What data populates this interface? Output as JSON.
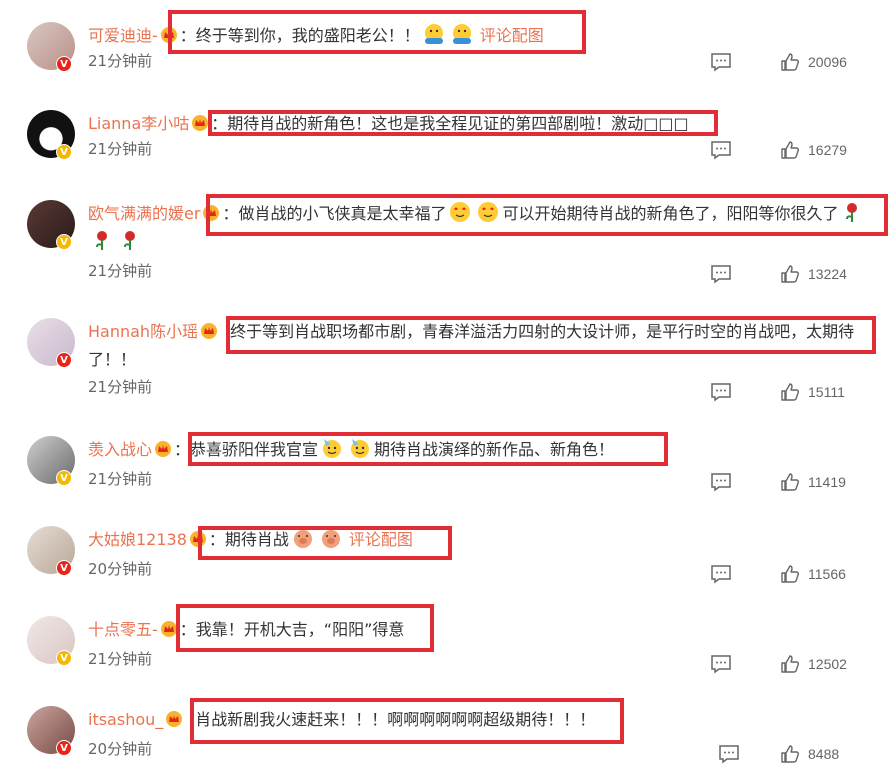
{
  "comments": [
    {
      "username": "可爱迪迪-",
      "text": "：终于等到你，我的盛阳老公！！",
      "emojis": [
        "emoji-palms",
        "emoji-palms"
      ],
      "tail": "评论配图",
      "time": "21分钟前",
      "likes": "20096",
      "badge": "red"
    },
    {
      "username": "Lianna李小咕",
      "text": "：期待肖战的新角色！这也是我全程见证的第四部剧啦！激动□□□",
      "emojis": [],
      "tail": "",
      "time": "21分钟前",
      "likes": "16279",
      "badge": "gold"
    },
    {
      "username": "欧气满满的媛er",
      "text": "：做肖战的小飞侠真是太幸福了",
      "emojis": [
        "emoji-hearts",
        "emoji-hearts"
      ],
      "text2": "可以开始期待肖战的新角色了，阳阳等你很久了",
      "emojis2": [
        "emoji-rose",
        "emoji-rose",
        "emoji-rose"
      ],
      "time": "21分钟前",
      "likes": "13224",
      "badge": "gold"
    },
    {
      "username": "Hannah陈小瑶",
      "text": "终于等到肖战职场都市剧，青春洋溢活力四射的大设计师，是平行时空的肖战吧，太期待了！！",
      "time": "21分钟前",
      "likes": "15111",
      "badge": "red"
    },
    {
      "username": "羡入战心",
      "text": "：恭喜骄阳伴我官宣",
      "emojis": [
        "emoji-party",
        "emoji-party"
      ],
      "text2": "期待肖战演绎的新作品、新角色！",
      "time": "21分钟前",
      "likes": "11419",
      "badge": "gold"
    },
    {
      "username": "大姑娘12138",
      "text": "：期待肖战",
      "emojis": [
        "emoji-pig",
        "emoji-pig"
      ],
      "tail": "评论配图",
      "time": "20分钟前",
      "likes": "11566",
      "badge": "red"
    },
    {
      "username": "十点零五-",
      "text": "：我靠！开机大吉，“阳阳”得意",
      "time": "21分钟前",
      "likes": "12502",
      "badge": "gold"
    },
    {
      "username": "itsashou_",
      "text": "肖战新剧我火速赶来！！！啊啊啊啊啊啊超级期待！！！",
      "time": "20分钟前",
      "likes": "8488",
      "badge": "red"
    }
  ],
  "colors": {
    "highlight": "#e22d36",
    "username": "#eb7350"
  }
}
